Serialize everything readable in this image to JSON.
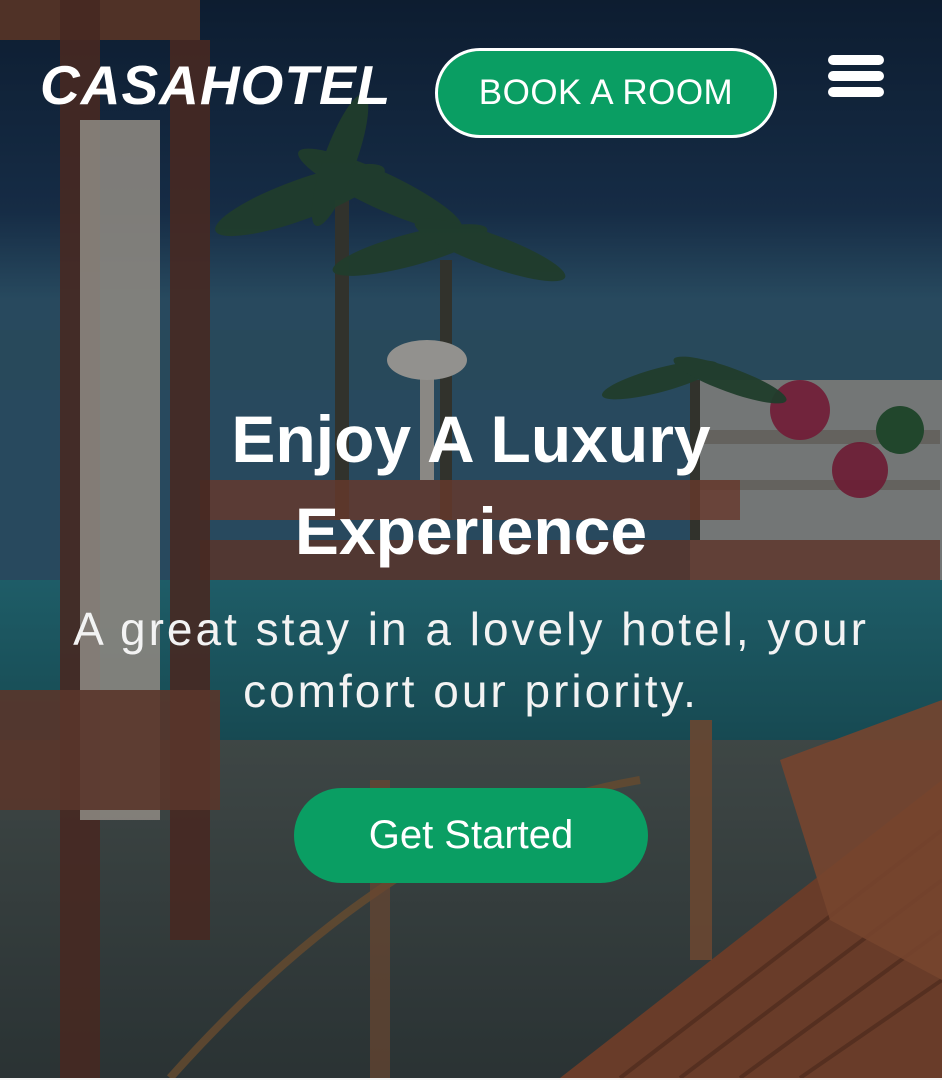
{
  "header": {
    "logo_text": "CASAHOTEL",
    "book_button_label": "BOOK A ROOM",
    "menu_icon": "hamburger-menu-icon"
  },
  "hero": {
    "headline": "Enjoy A Luxury Experience",
    "subheadline": "A great stay in a lovely hotel, your comfort our priority.",
    "cta_label": "Get Started",
    "background": "hotel-pool-with-palm-trees-image"
  },
  "colors": {
    "accent_green": "#0a9e63",
    "text_white": "#ffffff"
  }
}
